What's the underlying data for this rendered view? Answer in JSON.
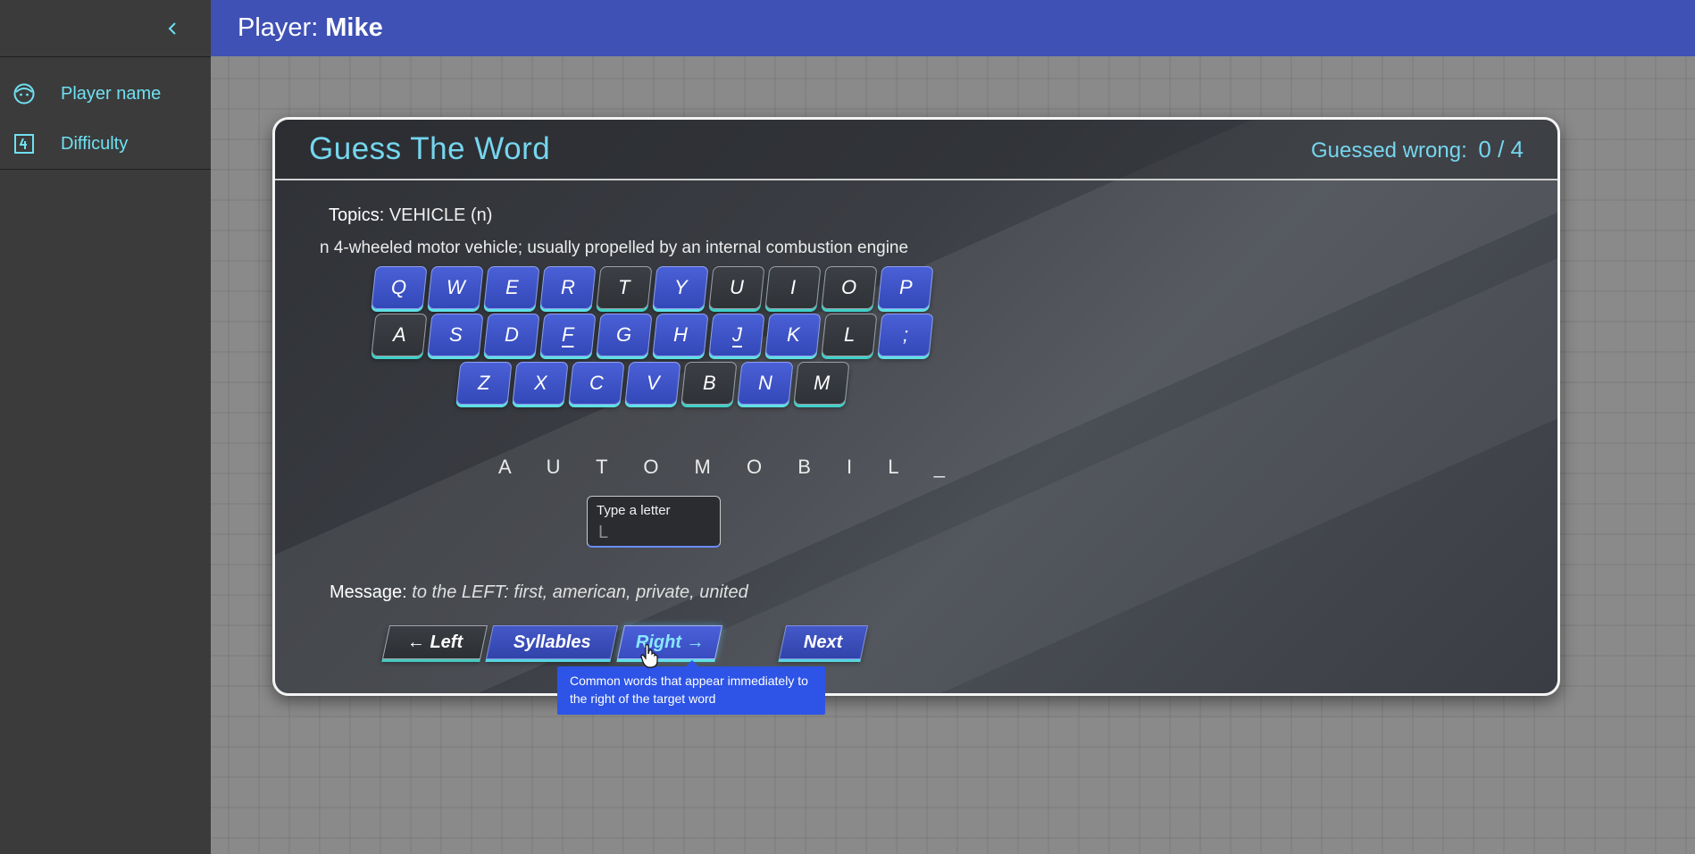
{
  "header": {
    "player_label": "Player:",
    "player_name": "Mike"
  },
  "sidebar": {
    "items": [
      {
        "label": "Player name",
        "icon": "face-icon"
      },
      {
        "label": "Difficulty",
        "icon": "difficulty-four-icon"
      }
    ]
  },
  "game": {
    "title": "Guess The Word",
    "wrong_label": "Guessed wrong:",
    "wrong_value": "0 / 4",
    "topics_label": "Topics:",
    "topics_value": "VEHICLE (n)",
    "definition": "n 4-wheeled motor vehicle; usually propelled by an internal combustion engine",
    "keyboard": {
      "row1": [
        {
          "k": "Q",
          "state": "active"
        },
        {
          "k": "W",
          "state": "active"
        },
        {
          "k": "E",
          "state": "active"
        },
        {
          "k": "R",
          "state": "active"
        },
        {
          "k": "T",
          "state": "used"
        },
        {
          "k": "Y",
          "state": "active"
        },
        {
          "k": "U",
          "state": "used"
        },
        {
          "k": "I",
          "state": "used"
        },
        {
          "k": "O",
          "state": "used"
        },
        {
          "k": "P",
          "state": "active"
        }
      ],
      "row2": [
        {
          "k": "A",
          "state": "used"
        },
        {
          "k": "S",
          "state": "active"
        },
        {
          "k": "D",
          "state": "active"
        },
        {
          "k": "F",
          "state": "active",
          "underline": true
        },
        {
          "k": "G",
          "state": "active"
        },
        {
          "k": "H",
          "state": "active"
        },
        {
          "k": "J",
          "state": "active",
          "underline": true
        },
        {
          "k": "K",
          "state": "active"
        },
        {
          "k": "L",
          "state": "used"
        },
        {
          "k": ";",
          "state": "active"
        }
      ],
      "row3": [
        {
          "k": "Z",
          "state": "active"
        },
        {
          "k": "X",
          "state": "active"
        },
        {
          "k": "C",
          "state": "active"
        },
        {
          "k": "V",
          "state": "active"
        },
        {
          "k": "B",
          "state": "used"
        },
        {
          "k": "N",
          "state": "active"
        },
        {
          "k": "M",
          "state": "used"
        }
      ]
    },
    "word_display": "A U T O M O B I L _",
    "input": {
      "label": "Type a letter",
      "placeholder": "L"
    },
    "message_label": "Message:",
    "message_value": "to the LEFT: first, american, private, united",
    "buttons": {
      "left": "← Left",
      "syllables": "Syllables",
      "right": "Right →",
      "next": "Next"
    },
    "tooltip": "Common words that appear immediately to the right of the target word"
  },
  "colors": {
    "header_bg": "#3f51b5",
    "accent_cyan": "#6fe0f2",
    "key_blue": "#3f51c8",
    "tooltip_bg": "#2d54e6"
  }
}
